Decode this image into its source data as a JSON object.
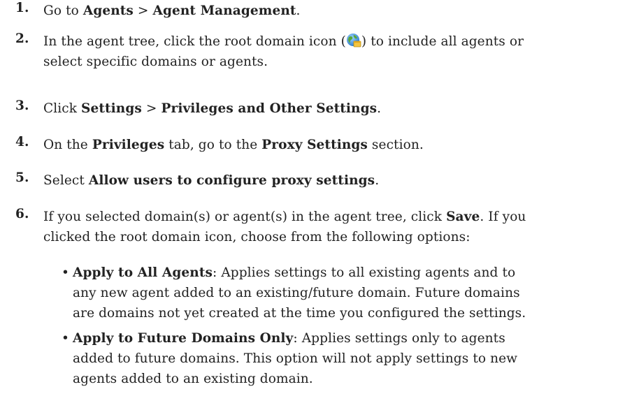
{
  "steps": [
    {
      "num": "1.",
      "t1": "Go to ",
      "b1": "Agents",
      "t2": " > ",
      "b2": "Agent Management",
      "t3": "."
    },
    {
      "num": "2.",
      "line1_a": "In the agent tree, click the root domain icon (",
      "line1_b": ") to include all agents or",
      "line2": "select specific domains or agents.",
      "icon": "root-domain-globe-icon"
    },
    {
      "num": "3.",
      "t1": "Click ",
      "b1": "Settings",
      "t2": " > ",
      "b2": "Privileges and Other Settings",
      "t3": "."
    },
    {
      "num": "4.",
      "t1": "On the ",
      "b1": "Privileges",
      "t2": " tab, go to the ",
      "b2": "Proxy Settings",
      "t3": " section."
    },
    {
      "num": "5.",
      "t1": "Select ",
      "b1": "Allow users to configure proxy settings",
      "t2": "."
    },
    {
      "num": "6.",
      "line1_a": "If you selected domain(s) or agent(s) in the agent tree, click ",
      "line1_b": "Save",
      "line1_c": ". If you",
      "line2": "clicked the root domain icon, choose from the following options:"
    }
  ],
  "options": [
    {
      "bullet": "•",
      "title": "Apply to All Agents",
      "line1": ": Applies settings to all existing agents and to",
      "line2": "any new agent added to an existing/future domain. Future domains",
      "line3": "are domains not yet created at the time you configured the settings."
    },
    {
      "bullet": "•",
      "title": "Apply to Future Domains Only",
      "line1": ": Applies settings only to agents",
      "line2": "added to future domains. This option will not apply settings to new",
      "line3": "agents added to an existing domain."
    }
  ]
}
